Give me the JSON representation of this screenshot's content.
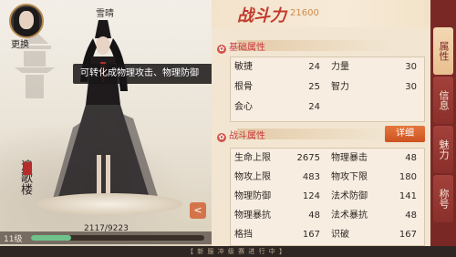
{
  "header": {
    "change_label": "更换",
    "character_name": "雪晴"
  },
  "tooltip": "可转化成物理攻击、物理防御",
  "logo_text": "浪歌楼",
  "level": {
    "label": "11级",
    "exp_text": "2117/9223",
    "exp_fraction": 0.2295
  },
  "footer_text": "【 新 服 冲 级 赛 进 行 中 】",
  "power": {
    "label": "战斗力",
    "value": "21600"
  },
  "basic_section": {
    "title": "基础属性",
    "stats": [
      {
        "name": "敏捷",
        "value": "24"
      },
      {
        "name": "力量",
        "value": "30"
      },
      {
        "name": "根骨",
        "value": "25"
      },
      {
        "name": "智力",
        "value": "30"
      },
      {
        "name": "会心",
        "value": "24"
      }
    ]
  },
  "combat_section": {
    "title": "战斗属性",
    "detail_button": "详细",
    "stats": [
      {
        "name": "生命上限",
        "value": "2675"
      },
      {
        "name": "物理暴击",
        "value": "48"
      },
      {
        "name": "物攻上限",
        "value": "483"
      },
      {
        "name": "物攻下限",
        "value": "180"
      },
      {
        "name": "物理防御",
        "value": "124"
      },
      {
        "name": "法术防御",
        "value": "141"
      },
      {
        "name": "物理暴抗",
        "value": "48"
      },
      {
        "name": "法术暴抗",
        "value": "48"
      },
      {
        "name": "格挡",
        "value": "167"
      },
      {
        "name": "识破",
        "value": "167"
      }
    ]
  },
  "tabs": [
    {
      "label": "属性",
      "active": true
    },
    {
      "label": "信息",
      "active": false
    },
    {
      "label": "魅力",
      "active": false
    },
    {
      "label": "称号",
      "active": false
    }
  ],
  "icons": {
    "share": "share-icon",
    "section": "flower-icon"
  },
  "colors": {
    "accent": "#c9373b",
    "detail_button": "#cc5321",
    "exp_fill": "#6fc28a",
    "tab_bg": "#7a2825"
  }
}
